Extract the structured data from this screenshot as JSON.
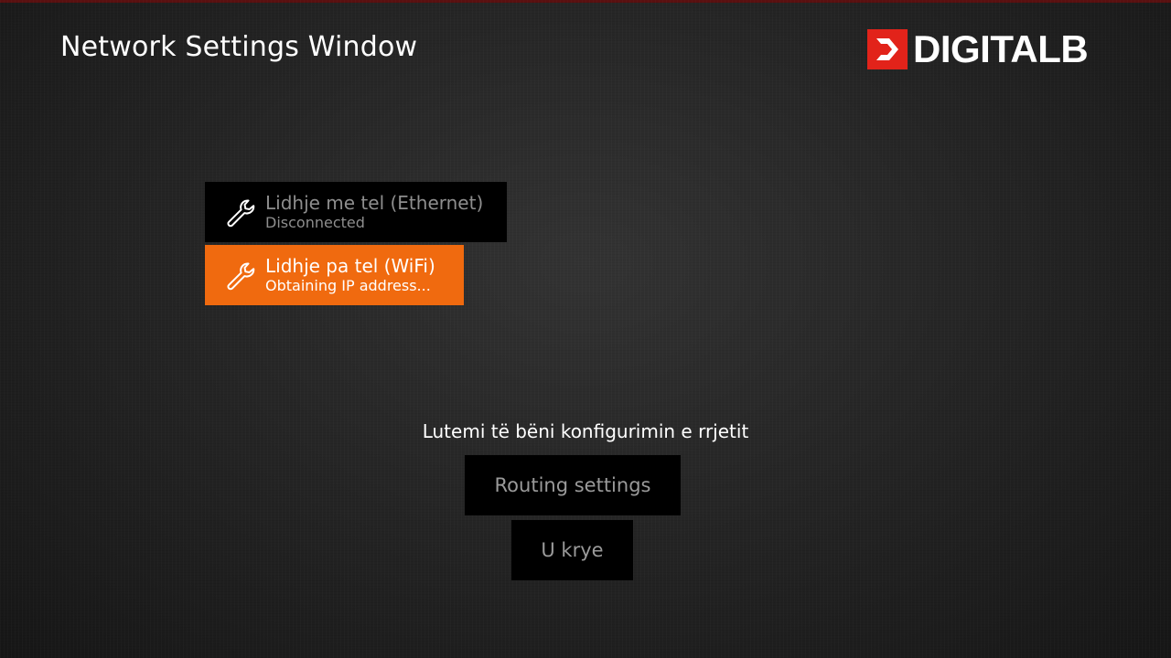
{
  "header": {
    "title": "Network Settings Window"
  },
  "logo": {
    "text": "DIGITALB",
    "brand_color": "#e2231a"
  },
  "connections": [
    {
      "name": "Lidhje me tel (Ethernet)",
      "status": "Disconnected",
      "icon": "wrench-icon",
      "selected": false
    },
    {
      "name": "Lidhje pa tel (WiFi)",
      "status": "Obtaining IP address...",
      "icon": "wrench-icon",
      "selected": true,
      "highlight_color": "#f06a0f"
    }
  ],
  "prompt": "Lutemi të bëni konfigurimin e rrjetit",
  "buttons": {
    "routing_label": "Routing settings",
    "done_label": "U krye"
  }
}
